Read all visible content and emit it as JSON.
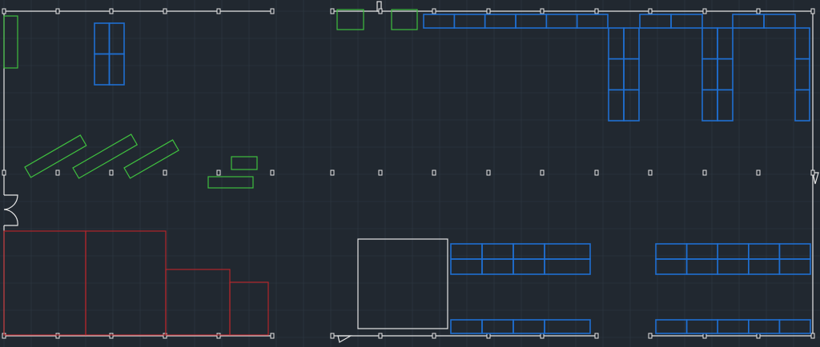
{
  "drawing": {
    "background": "#212830",
    "grid_color": "#2f3944",
    "wall_color": "#e6e6e6",
    "rack_color": "#1f6fd1",
    "equipment_color": "#3fbf3f",
    "zone_color": "#b3262b"
  },
  "layers": [
    {
      "name": "walls",
      "visible": true
    },
    {
      "name": "racks",
      "visible": true
    },
    {
      "name": "equipment",
      "visible": true
    },
    {
      "name": "zones",
      "visible": true
    }
  ]
}
